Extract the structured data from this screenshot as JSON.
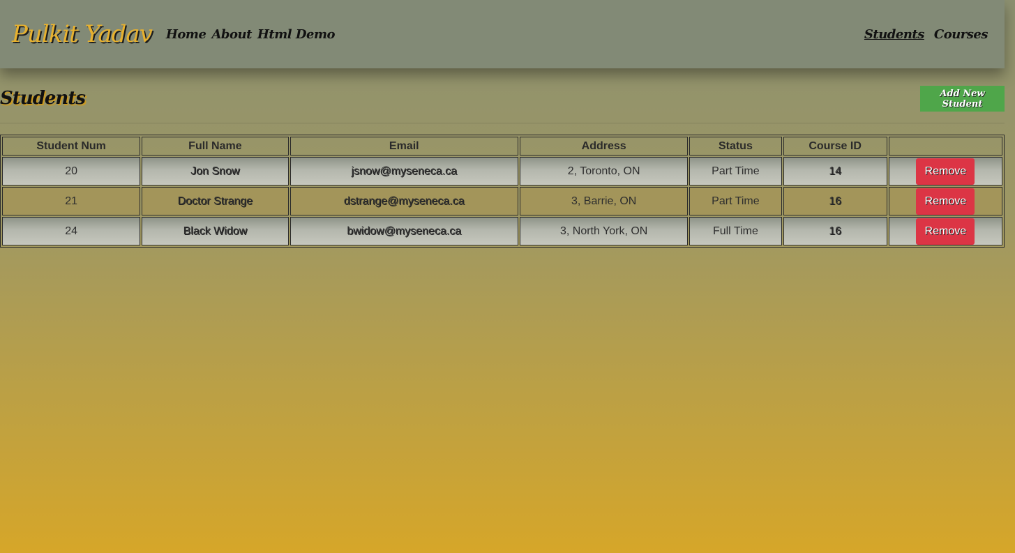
{
  "nav": {
    "brand": "Pulkit Yadav",
    "left_links": [
      "Home",
      "About",
      "Html Demo"
    ],
    "right_links": [
      "Students",
      "Courses"
    ]
  },
  "page": {
    "title": "Students",
    "add_button": "Add New Student"
  },
  "table": {
    "headers": [
      "Student Num",
      "Full Name",
      "Email",
      "Address",
      "Status",
      "Course ID",
      ""
    ],
    "rows": [
      {
        "num": "20",
        "name": "Jon Snow",
        "email": "jsnow@myseneca.ca",
        "address": "2, Toronto, ON",
        "status": "Part Time",
        "course": "14",
        "action": "Remove"
      },
      {
        "num": "21",
        "name": "Doctor Strange",
        "email": "dstrange@myseneca.ca",
        "address": "3, Barrie, ON",
        "status": "Part Time",
        "course": "16",
        "action": "Remove"
      },
      {
        "num": "24",
        "name": "Black Widow",
        "email": "bwidow@myseneca.ca",
        "address": "3, North York, ON",
        "status": "Full Time",
        "course": "16",
        "action": "Remove"
      }
    ]
  },
  "colors": {
    "brand": "#e7b12f",
    "add_button": "#4fa64a",
    "remove_button": "#dc3545",
    "navbar": "#828a76"
  }
}
